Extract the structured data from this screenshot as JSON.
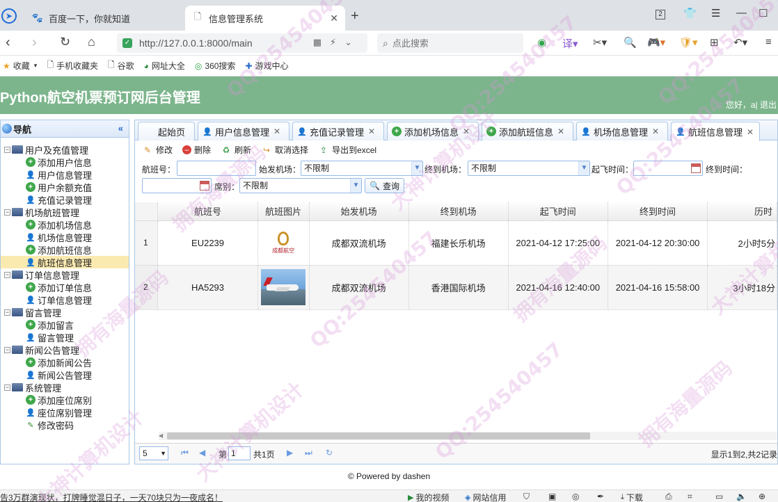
{
  "browser": {
    "tabs": [
      {
        "title": "百度一下，你就知道",
        "active": false
      },
      {
        "title": "信息管理系统",
        "active": true
      }
    ],
    "url": "http://127.0.0.1:8000/main",
    "search_placeholder": "点此搜索",
    "tab_count": "2",
    "bookmarks": [
      {
        "label": "收藏",
        "icon": "star-icon"
      },
      {
        "label": "手机收藏夹",
        "icon": "file-icon"
      },
      {
        "label": "谷歌",
        "icon": "file-icon"
      },
      {
        "label": "网址大全",
        "icon": "globe-icon"
      },
      {
        "label": "360搜索",
        "icon": "search360-icon"
      },
      {
        "label": "游戏中心",
        "icon": "gamepad-icon"
      }
    ]
  },
  "app": {
    "title": "Python航空机票预订网后台管理",
    "greeting": "您好，a| 退出"
  },
  "nav": {
    "title": "导航",
    "groups": [
      {
        "label": "用户及充值管理",
        "items": [
          {
            "label": "添加用户信息",
            "icon": "add"
          },
          {
            "label": "用户信息管理",
            "icon": "user"
          },
          {
            "label": "用户余额充值",
            "icon": "add"
          },
          {
            "label": "充值记录管理",
            "icon": "user"
          }
        ]
      },
      {
        "label": "机场航班管理",
        "items": [
          {
            "label": "添加机场信息",
            "icon": "add"
          },
          {
            "label": "机场信息管理",
            "icon": "user"
          },
          {
            "label": "添加航班信息",
            "icon": "add"
          },
          {
            "label": "航班信息管理",
            "icon": "user",
            "selected": true
          }
        ]
      },
      {
        "label": "订单信息管理",
        "items": [
          {
            "label": "添加订单信息",
            "icon": "add"
          },
          {
            "label": "订单信息管理",
            "icon": "user"
          }
        ]
      },
      {
        "label": "留言管理",
        "items": [
          {
            "label": "添加留言",
            "icon": "add"
          },
          {
            "label": "留言管理",
            "icon": "user"
          }
        ]
      },
      {
        "label": "新闻公告管理",
        "items": [
          {
            "label": "添加新闻公告",
            "icon": "add"
          },
          {
            "label": "新闻公告管理",
            "icon": "user"
          }
        ]
      },
      {
        "label": "系统管理",
        "items": [
          {
            "label": "添加座位席别",
            "icon": "add"
          },
          {
            "label": "座位席别管理",
            "icon": "user"
          },
          {
            "label": "修改密码",
            "icon": "pen"
          }
        ]
      }
    ]
  },
  "tabs": [
    {
      "label": "起始页",
      "icon": "none",
      "closable": false
    },
    {
      "label": "用户信息管理",
      "icon": "user",
      "closable": true
    },
    {
      "label": "充值记录管理",
      "icon": "user",
      "closable": true
    },
    {
      "label": "添加机场信息",
      "icon": "add",
      "closable": true
    },
    {
      "label": "添加航班信息",
      "icon": "add",
      "closable": true
    },
    {
      "label": "机场信息管理",
      "icon": "user",
      "closable": true
    },
    {
      "label": "航班信息管理",
      "icon": "user",
      "closable": true,
      "active": true
    }
  ],
  "toolbar": {
    "edit": "修改",
    "delete": "删除",
    "refresh": "刷新",
    "cancel_select": "取消选择",
    "export": "导出到excel"
  },
  "filters": {
    "flight_no_label": "航班号：",
    "flight_no_value": "",
    "start_airport_label": "始发机场：",
    "start_airport_value": "不限制",
    "end_airport_label": "终到机场：",
    "end_airport_value": "不限制",
    "depart_time_label": "起飞时间：",
    "arrive_time_label": "终到时间：",
    "seat_label": "席别：",
    "seat_value": "不限制",
    "query": "查询"
  },
  "grid": {
    "columns": [
      "航班号",
      "航班图片",
      "始发机场",
      "终到机场",
      "起飞时间",
      "终到时间",
      "历时"
    ],
    "rows": [
      {
        "rn": "1",
        "flight_no": "EU2239",
        "image": "chengdu-airlines-logo",
        "from": "成都双流机场",
        "to": "福建长乐机场",
        "depart": "2021-04-12 17:25:00",
        "arrive": "2021-04-12 20:30:00",
        "duration": "2小时5分"
      },
      {
        "rn": "2",
        "flight_no": "HA5293",
        "image": "airplane-photo",
        "from": "成都双流机场",
        "to": "香港国际机场",
        "depart": "2021-04-16 12:40:00",
        "arrive": "2021-04-16 15:58:00",
        "duration": "3小时18分"
      }
    ]
  },
  "pager": {
    "page_size": "5",
    "page_label": "第",
    "page_value": "1",
    "total_pages": "共1页",
    "info": "显示1到2,共2记录"
  },
  "footer": "© Powered by dashen",
  "statusbar": {
    "news": "告3万群演现状，打牌睡觉混日子，一天70块只为一夜成名！",
    "items": [
      "我的视频",
      "网站信用",
      "下载"
    ]
  },
  "watermark": {
    "texts": [
      "QQ:254540457",
      "拥有海量源码",
      "大神计算机设计"
    ]
  }
}
